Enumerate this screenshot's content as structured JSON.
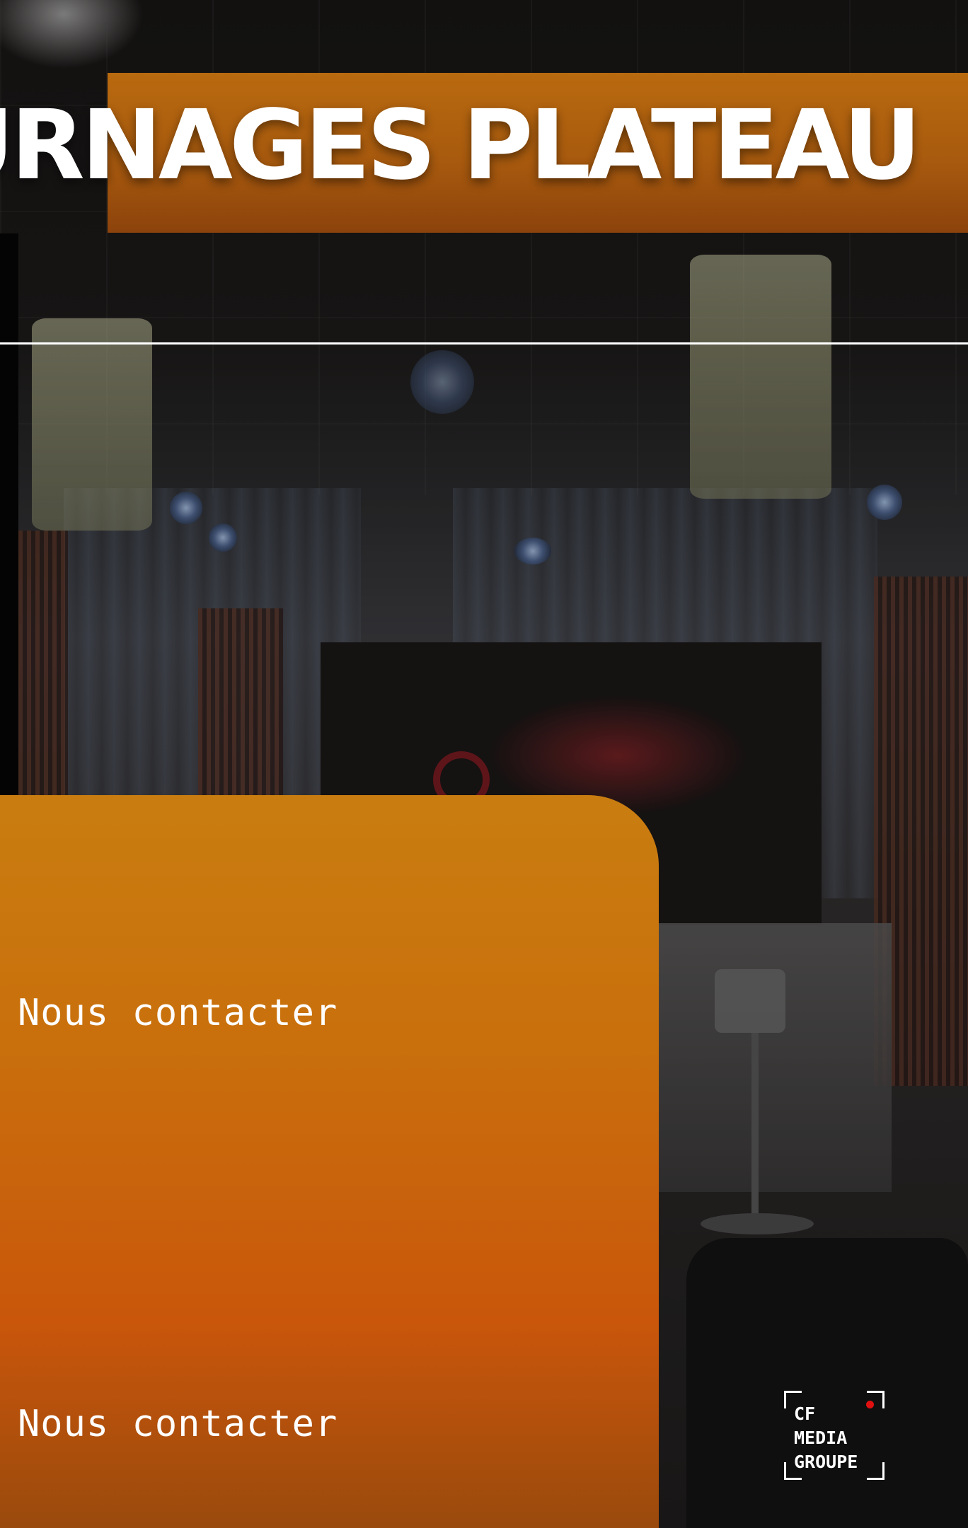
{
  "header": {
    "title": "URNAGES PLATEAU"
  },
  "contact": {
    "link_1": "Nous contacter",
    "link_2": "Nous contacter"
  },
  "logo": {
    "name": "CF MEDIA GROUPE",
    "lines": [
      "CF",
      "MEDIA",
      "GROUPE"
    ],
    "dot_color": "#e01010"
  },
  "colors": {
    "accent_orange": "#c97d10",
    "accent_orange_dark": "#c9560b",
    "banner": "#b96a0f"
  }
}
